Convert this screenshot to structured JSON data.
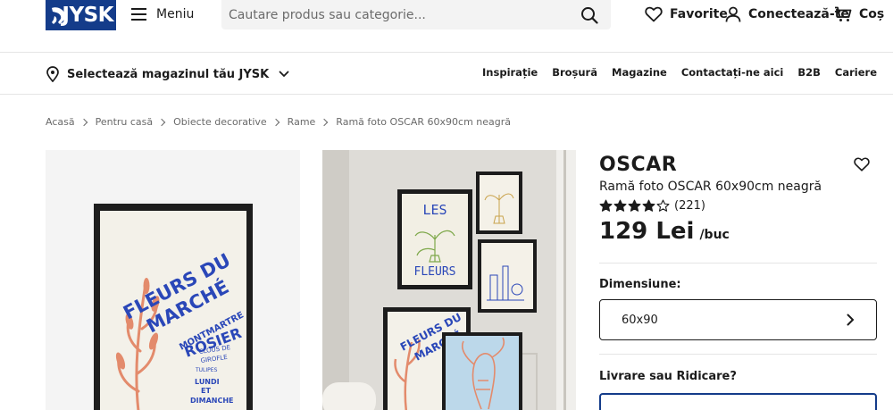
{
  "header": {
    "logo_text": "JYSK",
    "menu_label": "Meniu",
    "search_placeholder": "Cautare produs sau categorie...",
    "favorites_label": "Favorite",
    "login_label": "Conectează-te",
    "cart_label": "Coș",
    "brand_color": "#143c8a"
  },
  "subheader": {
    "store_label": "Selectează magazinul tău JYSK",
    "nav": [
      "Inspirație",
      "Broșură",
      "Magazine",
      "Contactați-ne aici",
      "B2B",
      "Cariere"
    ]
  },
  "breadcrumb": [
    "Acasă",
    "Pentru casă",
    "Obiecte decorative",
    "Rame",
    "Ramă foto OSCAR 60x90cm neagră"
  ],
  "product": {
    "brand": "OSCAR",
    "title": "Ramă foto OSCAR 60x90cm neagră",
    "rating": 4,
    "rating_max": 5,
    "review_count": "(221)",
    "price": "129 Lei",
    "price_unit": "/buc",
    "dimension_label": "Dimensiune:",
    "dimension_value": "60x90",
    "delivery_label": "Livrare sau Ridicare?"
  },
  "image1": {
    "poster_lines": [
      "FLEURS DU",
      "MARCHÉ",
      "MONTMARTRE",
      "ROSIER",
      "CLOUS DE",
      "GIROFLE",
      "TULIPES",
      "LUNDI",
      "ET",
      "DIMANCHE"
    ]
  },
  "image2": {
    "poster_top": [
      "LES",
      "FLEURS"
    ],
    "poster_bottom": [
      "FLEURS DU",
      "MARCHÉ"
    ]
  }
}
